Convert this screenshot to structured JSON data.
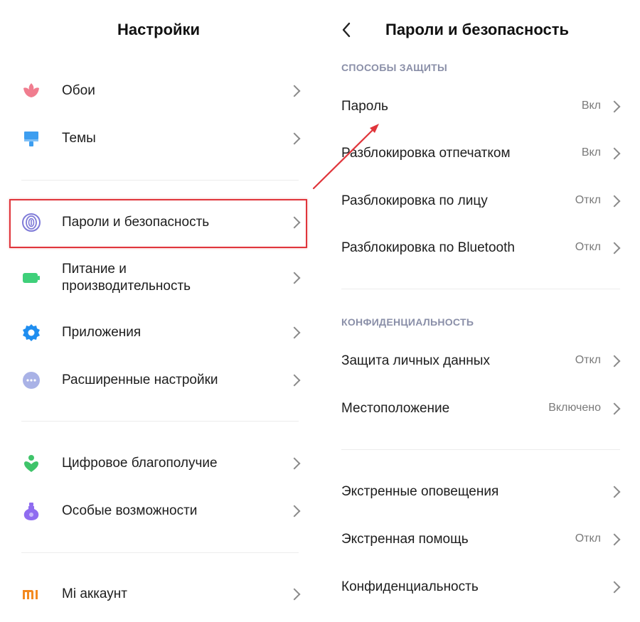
{
  "left": {
    "title": "Настройки",
    "items": [
      {
        "label": "Обои",
        "icon": "wallpaper-icon"
      },
      {
        "label": "Темы",
        "icon": "themes-icon"
      },
      {
        "label": "Пароли и безопасность",
        "icon": "fingerprint-icon"
      },
      {
        "label": "Питание и\nпроизводительность",
        "icon": "battery-icon"
      },
      {
        "label": "Приложения",
        "icon": "apps-gear-icon"
      },
      {
        "label": "Расширенные настройки",
        "icon": "more-dots-icon"
      },
      {
        "label": "Цифровое благополучие",
        "icon": "digital-wellbeing-icon"
      },
      {
        "label": "Особые возможности",
        "icon": "accessibility-icon"
      },
      {
        "label": "Mi аккаунт",
        "icon": "mi-icon"
      }
    ]
  },
  "right": {
    "title": "Пароли и безопасность",
    "section1": "СПОСОБЫ ЗАЩИТЫ",
    "section2": "КОНФИДЕНЦИАЛЬНОСТЬ",
    "items": [
      {
        "label": "Пароль",
        "value": "Вкл"
      },
      {
        "label": "Разблокировка отпечатком",
        "value": "Вкл"
      },
      {
        "label": "Разблокировка по лицу",
        "value": "Откл"
      },
      {
        "label": "Разблокировка по Bluetooth",
        "value": "Откл"
      },
      {
        "label": "Защита личных данных",
        "value": "Откл"
      },
      {
        "label": "Местоположение",
        "value": "Включено"
      },
      {
        "label": "Экстренные оповещения",
        "value": ""
      },
      {
        "label": "Экстренная помощь",
        "value": "Откл"
      },
      {
        "label": "Конфиденциальность",
        "value": ""
      }
    ]
  },
  "colors": {
    "highlight": "#e0353b",
    "arrow": "#e0353b",
    "wallpaper": "#f07d8f",
    "themes": "#3d9ef0",
    "fingerprint": "#7f7bd8",
    "battery": "#3fd07a",
    "apps": "#1f8ef0",
    "more": "#a9b2e6",
    "wellbeing": "#3fc46a",
    "accessibility": "#8f6cf0",
    "mi": "#f38a20"
  }
}
